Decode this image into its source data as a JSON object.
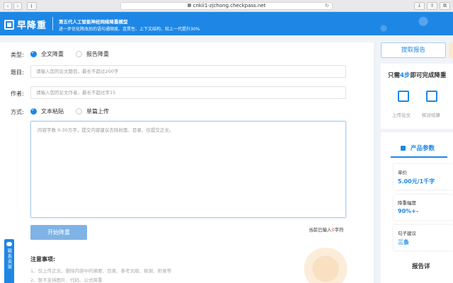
{
  "browser": {
    "url": "cnkii1-zjchong.checkpass.net"
  },
  "header": {
    "logo_text": "早降重",
    "title": "第五代人工智能神经网络降重模型",
    "subtitle": "进一步优化降改后的语句通顺度、连贯性、上下文结构，较上一代提升30%"
  },
  "form": {
    "type_label": "类型:",
    "type_options": [
      "全文降重",
      "报告降重"
    ],
    "title_label": "题目:",
    "title_placeholder": "请输入您的论文题目，最长不超过200字",
    "author_label": "作者:",
    "author_placeholder": "请输入您的论文作者，最长不超过字15",
    "mode_label": "方式:",
    "mode_options": [
      "文本粘贴",
      "单篇上传"
    ],
    "content_placeholder": "内容字数 0-30万字，提交内容建议去除封面、目录、仅提交正文。",
    "submit_label": "开始降重",
    "count_prefix": "当前已输入",
    "count_value": "0",
    "count_suffix": "字符"
  },
  "notes": {
    "title": "注意事项:",
    "items": [
      "1、仅上传正文，删除内容中的摘要、目录、参考文献、致谢、附录等",
      "2、暂不支持图片、代码、公式降重"
    ]
  },
  "contact": {
    "label": "联系卖家"
  },
  "sidebar": {
    "report_button": "提取报告",
    "steps_title_pre": "只需",
    "steps_title_num": "4步",
    "steps_title_post": "即可完成降重",
    "steps": [
      "上传论文",
      "核对结算"
    ],
    "params_tab": "产品参数",
    "params": [
      {
        "label": "单价",
        "value": "5.00元/1千字"
      },
      {
        "label": "降重幅度",
        "value": "90%+-"
      },
      {
        "label": "句子建议",
        "value": "三条"
      }
    ],
    "detail_tab": "报告详"
  },
  "colors": {
    "brand": "#1e87e6",
    "submit_disabled": "#7fb3e6",
    "count_highlight": "#e74c3c"
  }
}
